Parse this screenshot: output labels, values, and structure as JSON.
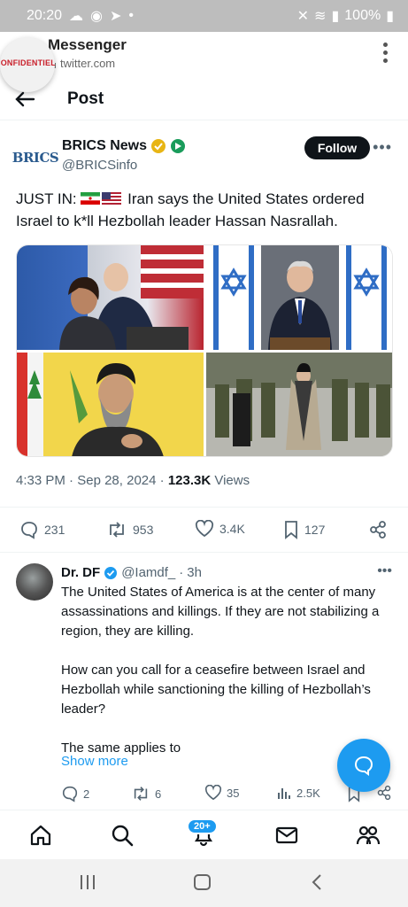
{
  "status_bar": {
    "time": "20:20",
    "battery": "100%"
  },
  "app_bar": {
    "title": "Messenger",
    "url": "twitter.com",
    "watermark": "CONFIDENTIELLT"
  },
  "post_header": {
    "title": "Post"
  },
  "tweet": {
    "author_name": "BRICS News",
    "author_handle": "@BRICSinfo",
    "avatar_text": "BRICS",
    "follow_label": "Follow",
    "prefix": "JUST IN:",
    "text": "Iran says the United States ordered Israel to k*ll Hezbollah leader Hassan Nasrallah.",
    "time": "4:33 PM",
    "date": "Sep 28, 2024",
    "views_count": "123.3K",
    "views_label": "Views",
    "replies": "231",
    "reposts": "953",
    "likes": "3.4K",
    "bookmarks": "127"
  },
  "reply": {
    "name": "Dr. DF",
    "handle": "@Iamdf_",
    "age": "3h",
    "paragraphs": [
      "The United States of America is at the center of many assassinations and killings. If they are not stabilizing a region, they are killing.",
      "How can you call for a ceasefire between Israel and Hezbollah while sanctioning the killing of Hezbollah’s leader?",
      "The same applies to"
    ],
    "show_more": "Show more",
    "replies": "2",
    "reposts": "6",
    "likes": "35",
    "views": "2.5K"
  },
  "tab_bar": {
    "notif_badge": "20+"
  },
  "colors": {
    "accent": "#1d9bf0",
    "text": "#0f1419",
    "muted": "#536471"
  }
}
